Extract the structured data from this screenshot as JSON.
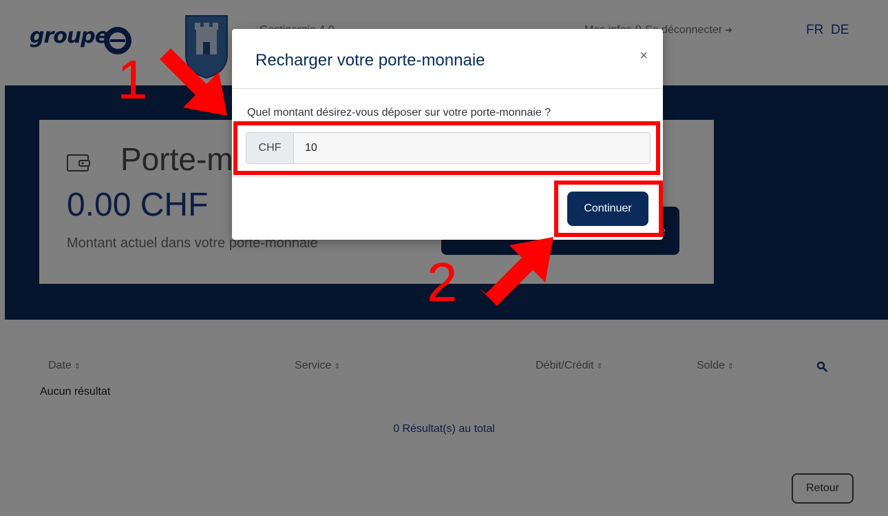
{
  "header": {
    "logo_text": "groupe",
    "app_title": "Gestinergie 4.0",
    "my_info": "Mes infos ()",
    "logout": "Se déconnecter",
    "lang_fr": "FR",
    "lang_de": "DE"
  },
  "wallet": {
    "title": "Porte-monnaie",
    "amount": "0.00 CHF",
    "description": "Montant actuel dans votre porte-monnaie"
  },
  "table": {
    "headers": [
      "Date",
      "Service",
      "Débit/Crédit",
      "Solde"
    ],
    "no_result": "Aucun résultat",
    "total": "0 Résultat(s) au total"
  },
  "back_button": "Retour",
  "modal": {
    "title": "Recharger votre porte-monnaie",
    "close": "×",
    "question": "Quel montant désirez-vous déposer sur votre porte-monnaie ?",
    "currency": "CHF",
    "amount_value": "10",
    "continue": "Continuer"
  },
  "annotations": {
    "step1": "1",
    "step2": "2",
    "highlight_color": "#ff0000"
  },
  "colors": {
    "brand_navy": "#0a2b5a",
    "link_blue": "#1a3b86"
  }
}
